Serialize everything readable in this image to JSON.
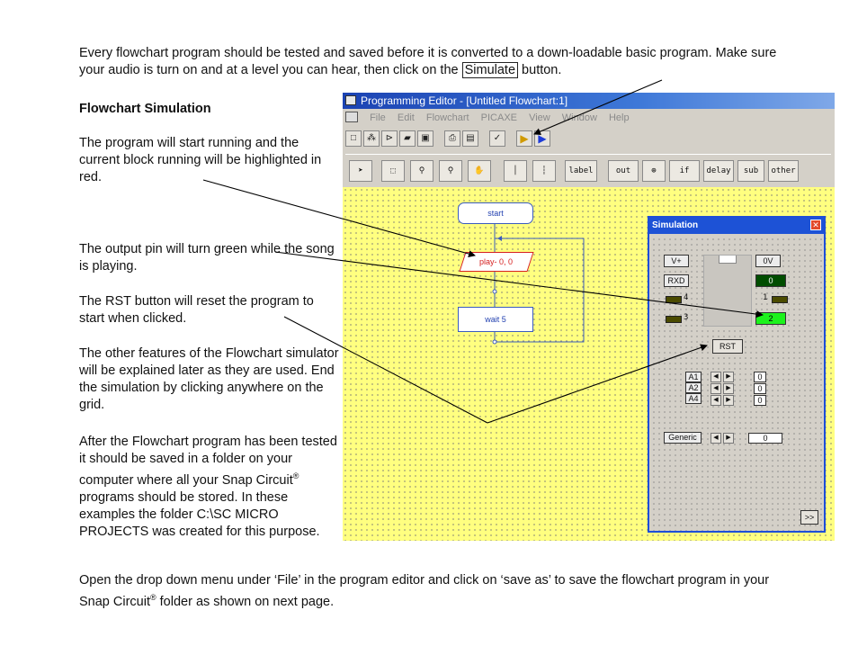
{
  "intro": {
    "before": "Every flowchart program should be tested and saved before it is converted to a down-loadable basic program. Make sure your audio is turn on and at a level you can hear, then click on the ",
    "button": "Simulate",
    "after": " button."
  },
  "heading": "Flowchart Simulation",
  "paragraphs": {
    "p1": "The program will start running and the current block running will be highlighted in red.",
    "p2": "The output pin will turn green while the song is playing.",
    "p3": "The RST button will reset the program to start when clicked.",
    "p4": "The other features of the Flowchart simulator will be explained later as they are used. End the simulation by clicking anywhere on the grid.",
    "p5_a": "After the Flowchart program has been tested it should be saved in a folder on your computer where all your Snap Circuit",
    "p5_reg": "®",
    "p5_b": " programs should be stored. In these examples the folder C:\\SC MICRO PROJECTS was created for this purpose."
  },
  "outro": {
    "a": "Open the drop down menu under ‘File’ in the program editor and click on ‘save as’ to save the flowchart program in your Snap Circuit",
    "reg": "®",
    "b": " folder as shown on next page."
  },
  "editor": {
    "title": "Programming Editor  - [Untitled Flowchart:1]",
    "menu": [
      "File",
      "Edit",
      "Flowchart",
      "PICAXE",
      "View",
      "Window",
      "Help"
    ],
    "tools": [
      "label",
      "out",
      "if",
      "delay",
      "sub",
      "other"
    ]
  },
  "flowchart": {
    "start": "start",
    "play": "play- 0, 0",
    "wait": "wait 5"
  },
  "simulation": {
    "title": "Simulation",
    "vplus": "V+",
    "zero_v": "0V",
    "rxd": "RXD",
    "pin0": "0",
    "pin1": "1",
    "pin2": "2",
    "pin3": "3",
    "pin4": "4",
    "rst": "RST",
    "a1": "A1",
    "a2": "A2",
    "a4": "A4",
    "v1": "0",
    "v2": "0",
    "v3": "0",
    "generic": "Generic",
    "generic_val": "0",
    "more": ">>"
  }
}
